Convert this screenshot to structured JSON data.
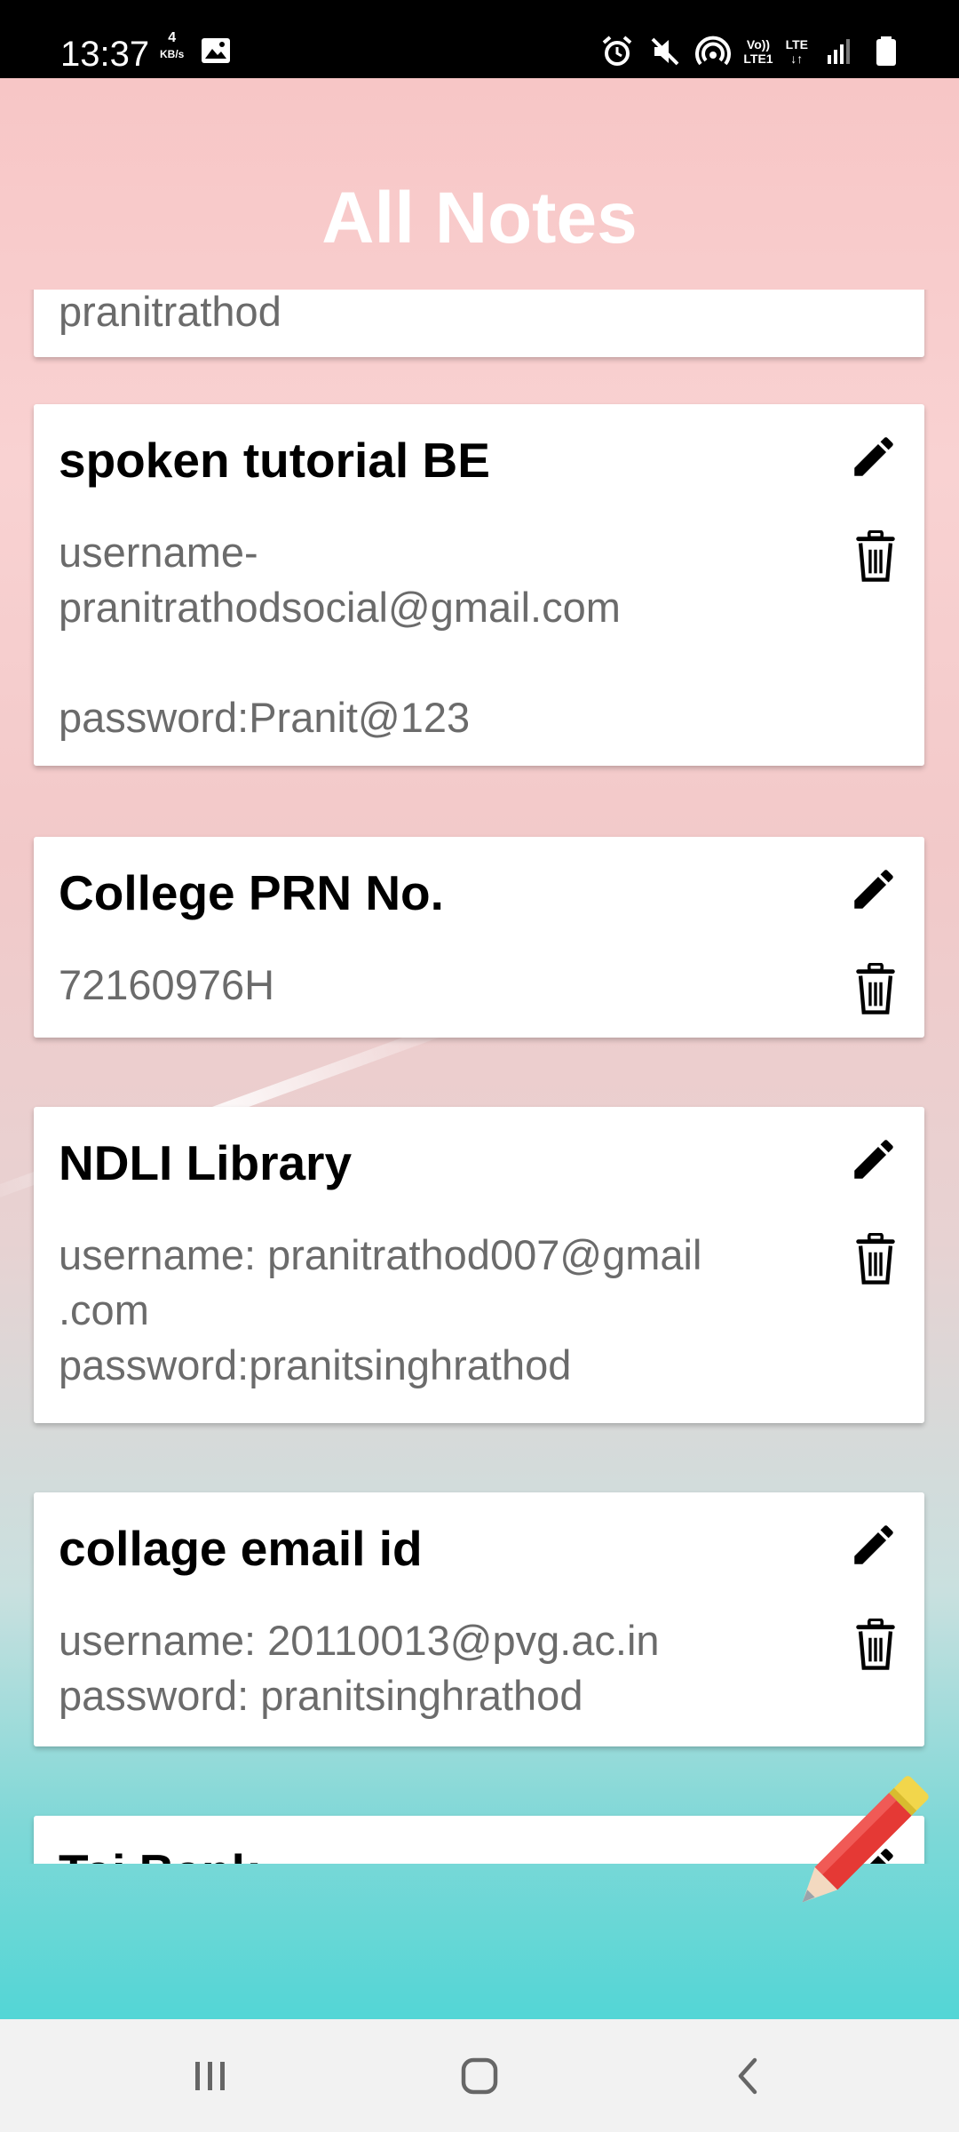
{
  "status_bar": {
    "time": "13:37",
    "speed_value": "4",
    "speed_unit": "KB/s",
    "lte1_top": "Vo))",
    "lte1_bottom": "LTE1",
    "lte2_top": "LTE",
    "lte2_bottom": "↓↑"
  },
  "header": {
    "title": "All Notes"
  },
  "notes": [
    {
      "title": "",
      "body": "pranitrathod"
    },
    {
      "title": "spoken tutorial BE",
      "body": "username-\npranitrathodsocial@gmail.com\n\npassword:Pranit@123"
    },
    {
      "title": "College PRN No.",
      "body": "72160976H"
    },
    {
      "title": "NDLI Library",
      "body": "username: pranitrathod007@gmail\n.com\npassword:pranitsinghrathod"
    },
    {
      "title": "collage email id",
      "body": "username: 20110013@pvg.ac.in\npassword: pranitsinghrathod"
    },
    {
      "title": "Tai  Bank",
      "body": ""
    }
  ],
  "icons": {
    "edit": "pencil-icon",
    "delete": "trash-icon",
    "fab": "pencil-fab-icon"
  },
  "colors": {
    "fab_red": "#e53935",
    "fab_yellow": "#f2d64b",
    "accent_teal": "#53d6d6"
  }
}
